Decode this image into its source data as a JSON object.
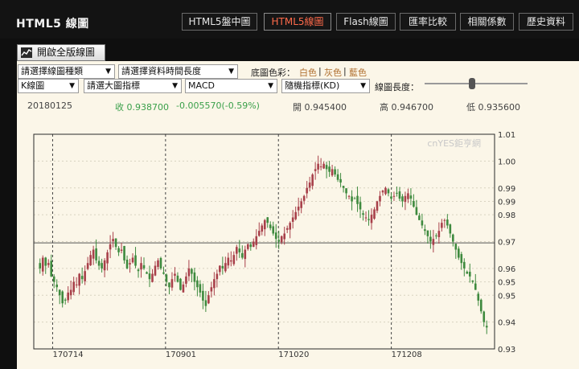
{
  "header": {
    "title": "HTML5 線圖",
    "tabs": [
      {
        "label": "HTML5盤中圖",
        "active": false
      },
      {
        "label": "HTML5線圖",
        "active": true
      },
      {
        "label": "Flash線圖",
        "active": false
      },
      {
        "label": "匯率比較",
        "active": false
      },
      {
        "label": "相關係數",
        "active": false
      },
      {
        "label": "歷史資料",
        "active": false
      }
    ]
  },
  "toolbar": {
    "full_chart_label": "開啟全版線圖",
    "chart_type_select": "請選擇線圖種類",
    "time_length_select": "請選擇資料時間長度",
    "bg_color_label": "底圖色彩：",
    "bg_colors": [
      "白色",
      "灰色",
      "藍色"
    ],
    "kline_select": "K線圖",
    "main_indicator_select": "請選大圖指標",
    "sub_indicator_select": "MACD",
    "oscillator_select": "隨機指標(KD)",
    "line_length_label": "線圖長度：",
    "line_length_level": 0.46
  },
  "quote": {
    "date": "20180125",
    "close_label": "收",
    "close": "0.938700",
    "change": "-0.005570(-0.59%)",
    "open_label": "開",
    "open": "0.945400",
    "high_label": "高",
    "high": "0.946700",
    "low_label": "低",
    "low": "0.935600"
  },
  "colors": {
    "up": "#a8404a",
    "down": "#3e8a3e",
    "background": "#fbf6e8"
  },
  "chart_data": {
    "type": "candlestick",
    "watermark": "cnYES鉅亨網",
    "x_tick_labels": [
      "170714",
      "170901",
      "171020",
      "171208"
    ],
    "y_tick_labels": [
      "1.01",
      "1.00",
      "0.99",
      "0.99",
      "0.98",
      "0.97",
      "0.96",
      "0.95",
      "0.95",
      "0.94",
      "0.93"
    ],
    "y_tick_values": [
      1.01,
      1.0,
      0.99,
      0.985,
      0.98,
      0.97,
      0.96,
      0.955,
      0.95,
      0.94,
      0.93
    ],
    "ylim": [
      0.93,
      1.01
    ],
    "reference_line": 0.9695,
    "vertical_markers": [
      0.02,
      0.265,
      0.51,
      0.755
    ],
    "close_series": [
      0.96,
      0.964,
      0.961,
      0.962,
      0.957,
      0.955,
      0.953,
      0.95,
      0.947,
      0.948,
      0.951,
      0.952,
      0.955,
      0.954,
      0.958,
      0.956,
      0.959,
      0.962,
      0.965,
      0.967,
      0.963,
      0.961,
      0.96,
      0.963,
      0.966,
      0.969,
      0.971,
      0.968,
      0.966,
      0.967,
      0.963,
      0.96,
      0.962,
      0.964,
      0.961,
      0.959,
      0.962,
      0.96,
      0.958,
      0.956,
      0.958,
      0.961,
      0.963,
      0.96,
      0.958,
      0.955,
      0.953,
      0.956,
      0.958,
      0.955,
      0.952,
      0.954,
      0.957,
      0.96,
      0.958,
      0.955,
      0.953,
      0.951,
      0.948,
      0.946,
      0.95,
      0.953,
      0.956,
      0.958,
      0.961,
      0.96,
      0.962,
      0.964,
      0.963,
      0.965,
      0.968,
      0.966,
      0.964,
      0.967,
      0.969,
      0.968,
      0.97,
      0.972,
      0.974,
      0.976,
      0.978,
      0.977,
      0.975,
      0.973,
      0.971,
      0.97,
      0.972,
      0.973,
      0.975,
      0.977,
      0.979,
      0.981,
      0.983,
      0.985,
      0.987,
      0.99,
      0.992,
      0.995,
      0.997,
      0.999,
      0.998,
      0.999,
      0.997,
      0.996,
      0.997,
      0.995,
      0.993,
      0.992,
      0.99,
      0.988,
      0.987,
      0.985,
      0.986,
      0.984,
      0.982,
      0.98,
      0.979,
      0.978,
      0.98,
      0.982,
      0.985,
      0.987,
      0.989,
      0.99,
      0.988,
      0.986,
      0.987,
      0.988,
      0.986,
      0.985,
      0.987,
      0.988,
      0.986,
      0.983,
      0.98,
      0.978,
      0.976,
      0.974,
      0.972,
      0.97,
      0.971,
      0.972,
      0.974,
      0.977,
      0.978,
      0.976,
      0.973,
      0.97,
      0.967,
      0.964,
      0.962,
      0.96,
      0.958,
      0.957,
      0.955,
      0.952,
      0.948,
      0.944,
      0.94,
      0.938
    ]
  }
}
